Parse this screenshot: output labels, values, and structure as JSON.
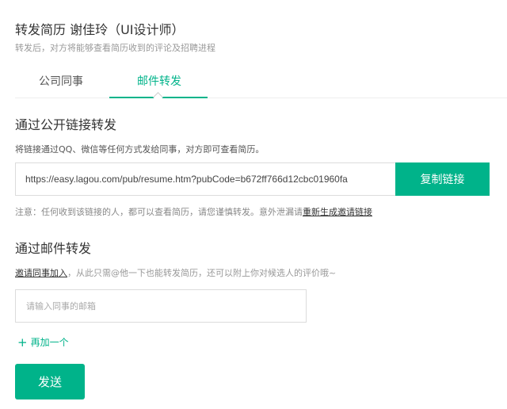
{
  "header": {
    "title": "转发简历 谢佳玲（UI设计师）",
    "subtitle": "转发后，对方将能够查看简历收到的评论及招聘进程"
  },
  "tabs": [
    {
      "label": "公司同事",
      "active": false
    },
    {
      "label": "邮件转发",
      "active": true
    }
  ],
  "public_link": {
    "title": "通过公开链接转发",
    "description": "将链接通过QQ、微信等任何方式发给同事，对方即可查看简历。",
    "url": "https://easy.lagou.com/pub/resume.htm?pubCode=b672ff766d12cbc01960fa",
    "copy_label": "复制链接",
    "notice_prefix": "注意：任何收到该链接的人，都可以查看简历，请您谨慎转发。意外泄漏请",
    "notice_link": "重新生成邀请链接"
  },
  "email": {
    "title": "通过邮件转发",
    "invite_link": "邀请同事加入",
    "description_suffix": "，从此只需@他一下也能转发简历，还可以附上你对候选人的评价哦~",
    "input_placeholder": "请输入同事的邮箱",
    "add_more_label": "再加一个",
    "send_label": "发送"
  },
  "colors": {
    "accent": "#00b38a"
  }
}
